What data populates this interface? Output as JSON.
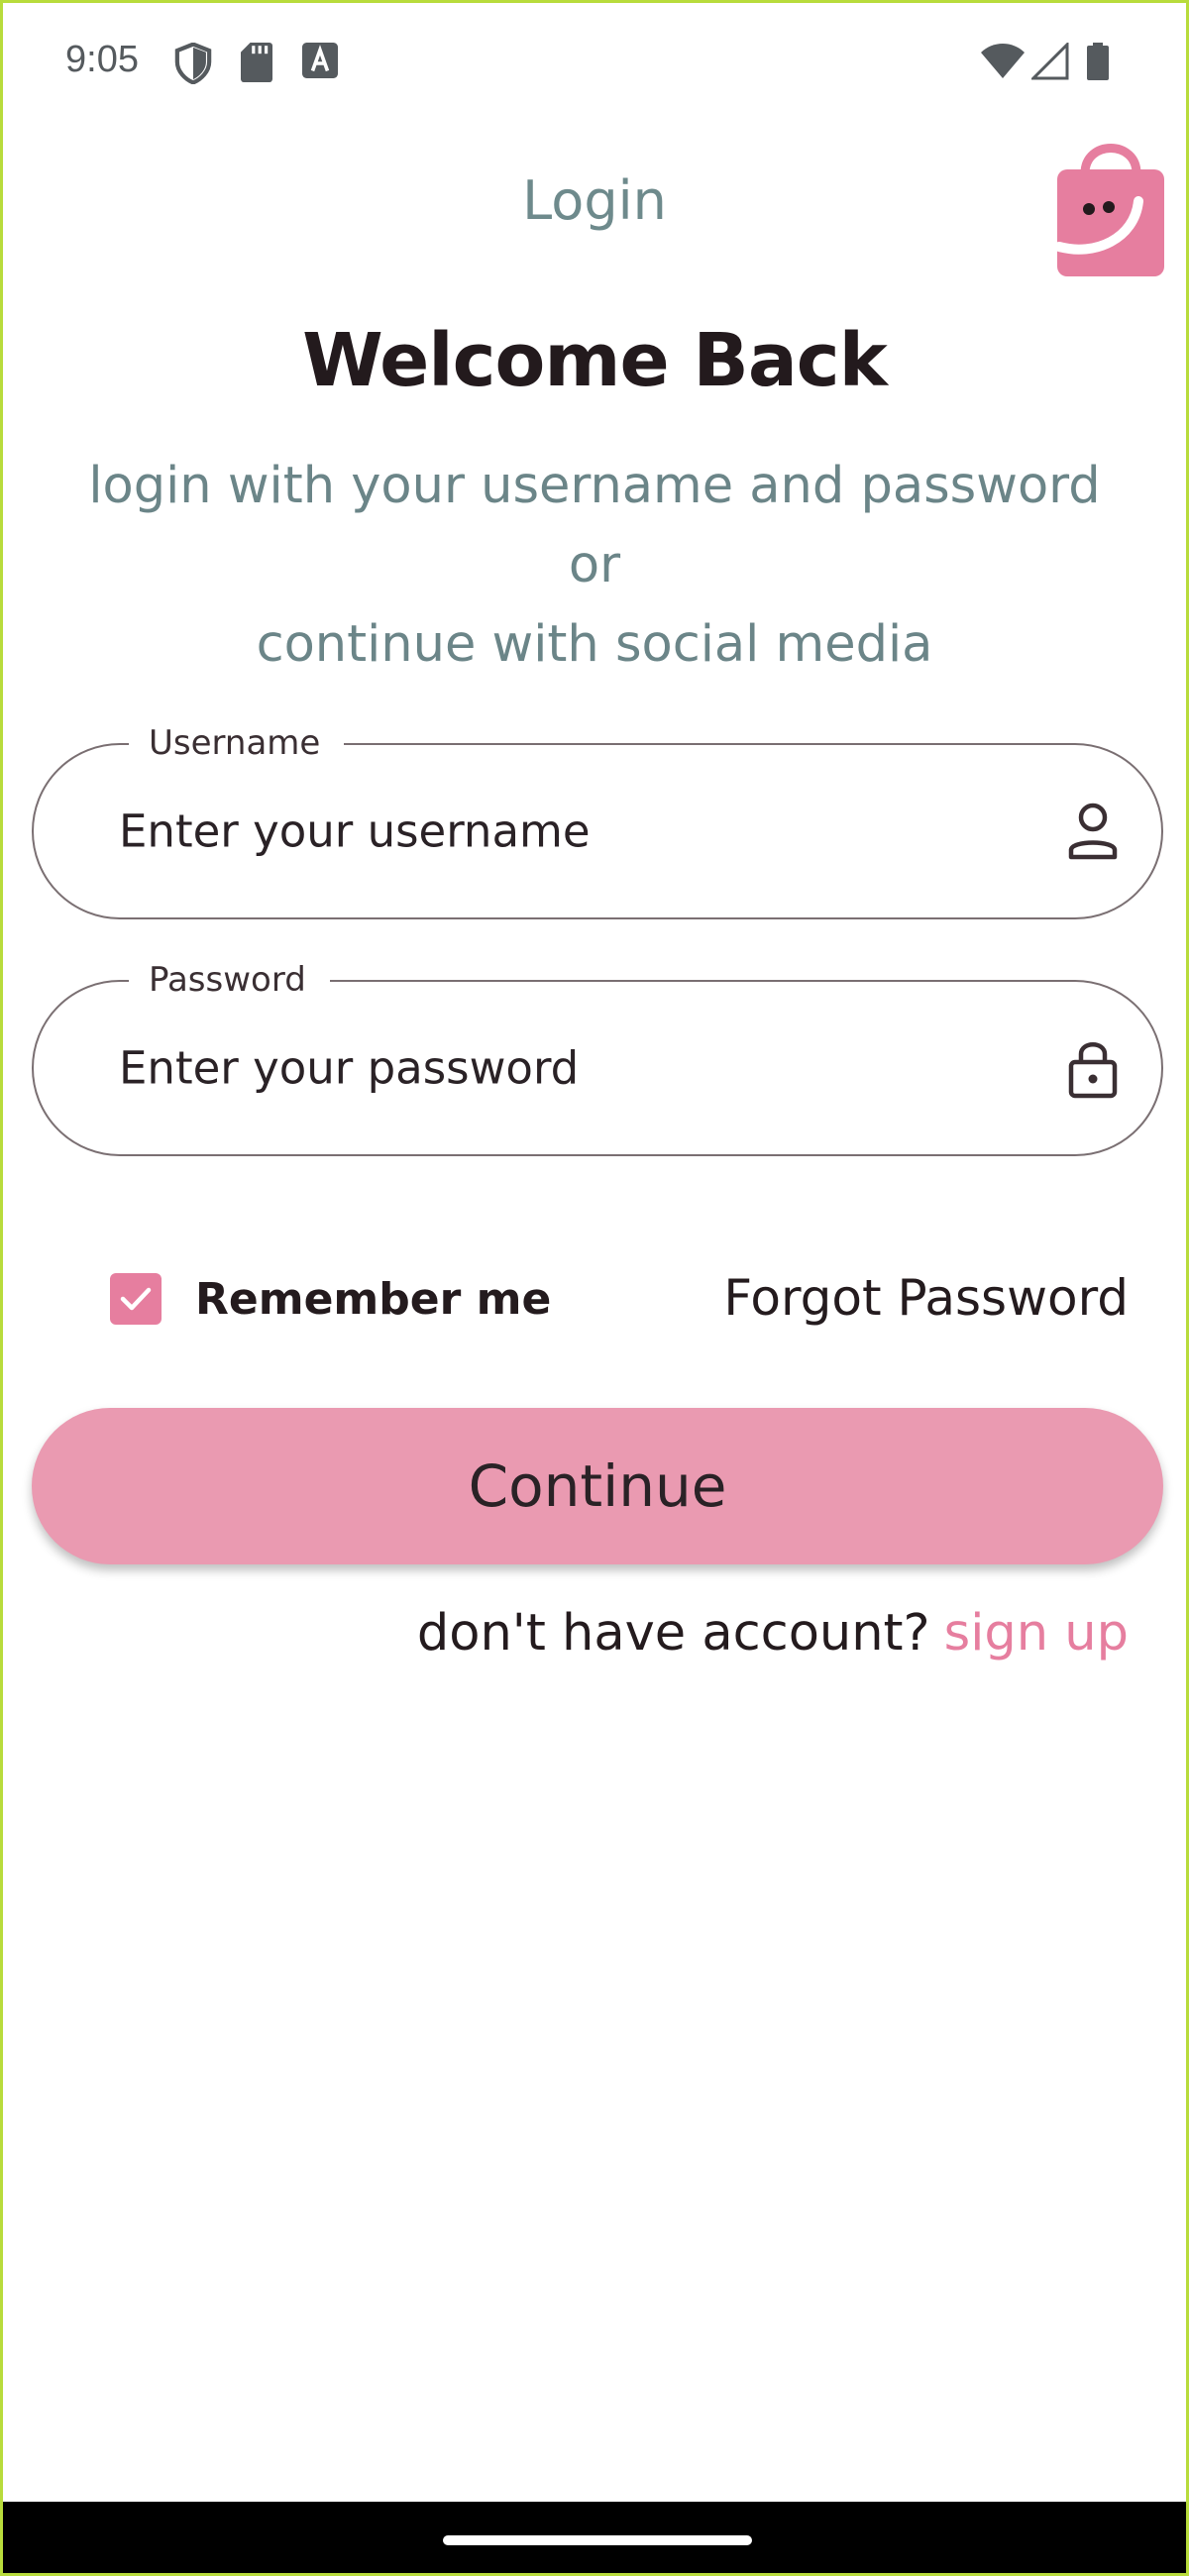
{
  "status_bar": {
    "time": "9:05",
    "left_icons": [
      "shield-icon",
      "sd-card-icon",
      "font-a-icon"
    ],
    "right_icons": [
      "wifi-icon",
      "cellular-signal-icon",
      "battery-icon"
    ]
  },
  "header": {
    "title": "Login",
    "logo_icon": "shopping-bag-smile-logo"
  },
  "welcome": {
    "heading": "Welcome Back",
    "subtitle_line1": "login with your username and password or",
    "subtitle_line2": "continue with social media"
  },
  "form": {
    "username": {
      "label": "Username",
      "placeholder": "Enter your username",
      "value": "",
      "icon": "person-icon"
    },
    "password": {
      "label": "Password",
      "placeholder": "Enter your password",
      "value": "",
      "icon": "lock-icon"
    },
    "remember_me": {
      "label": "Remember me",
      "checked": true
    },
    "forgot_password_label": "Forgot Password",
    "continue_label": "Continue",
    "signup_prompt": "don't have account?",
    "signup_link": "sign up"
  },
  "colors": {
    "accent": "#e67e9f",
    "button": "#ea9ab1",
    "muted_text": "#6b8588",
    "dark_text": "#241b1e",
    "frame_border": "#b8dc3c"
  }
}
